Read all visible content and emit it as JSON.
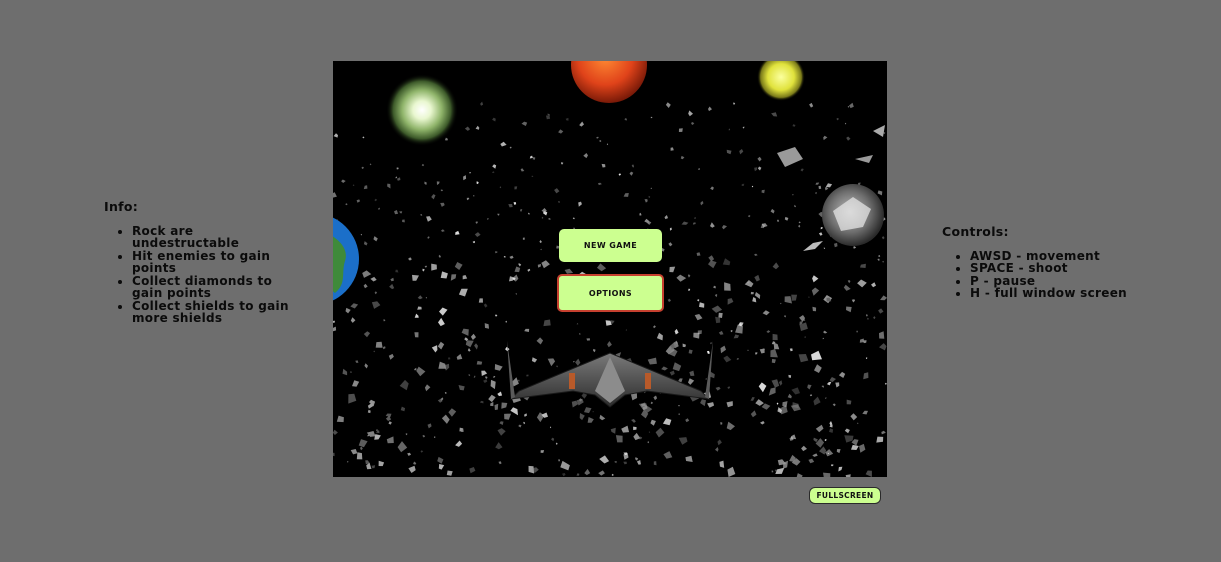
{
  "info": {
    "title": "Info:",
    "items": [
      "Rock are undestructable",
      "Hit enemies to gain points",
      "Collect diamonds to gain points",
      "Collect shields to gain more shields"
    ]
  },
  "controls": {
    "title": "Controls:",
    "items": [
      "AWSD - movement",
      "SPACE - shoot",
      "P - pause",
      "H - full window screen"
    ]
  },
  "menu": {
    "new_game": "NEW GAME",
    "options": "OPTIONS"
  },
  "fullscreen_label": "FULLSCREEN",
  "colors": {
    "page_background": "#6e6e6e",
    "button_fill": "#ccff90",
    "options_border": "#c6402f",
    "space": "#000000"
  },
  "scene": {
    "objects": [
      "green-glowing-star",
      "red-sun",
      "yellow-moon",
      "earth-planet",
      "grey-asteroid-planet",
      "asteroid-field",
      "spaceship"
    ]
  }
}
